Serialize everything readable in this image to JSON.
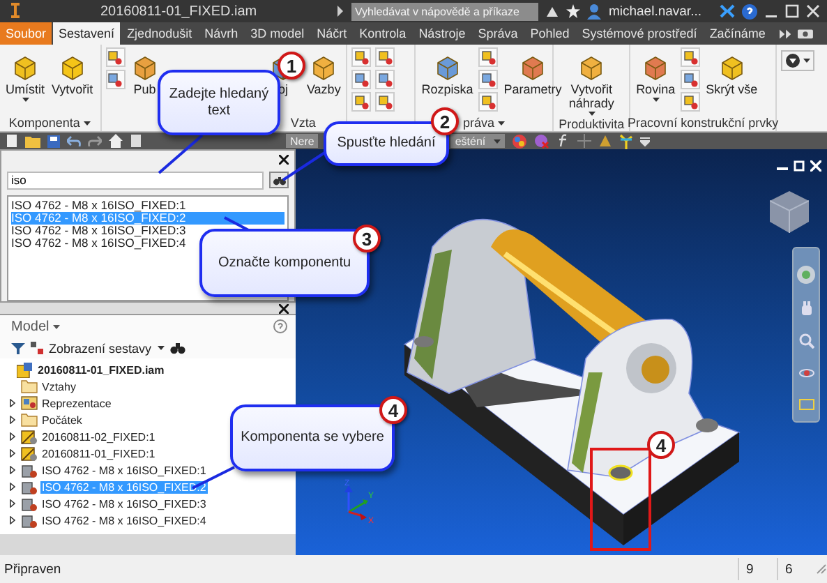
{
  "window": {
    "title": "20160811-01_FIXED.iam"
  },
  "title_bar": {
    "search": {
      "placeholder": "Vyhledávat v nápovědě a příkaze"
    },
    "user": "michael.navar..."
  },
  "ribbon_tabs": [
    {
      "label": "Soubor",
      "kind": "file",
      "selected": false
    },
    {
      "label": "Sestavení",
      "kind": "tab",
      "selected": true
    },
    {
      "label": "Zjednodušit",
      "kind": "tab",
      "selected": false
    },
    {
      "label": "Návrh",
      "kind": "tab",
      "selected": false
    },
    {
      "label": "3D model",
      "kind": "tab",
      "selected": false
    },
    {
      "label": "Náčrt",
      "kind": "tab",
      "selected": false
    },
    {
      "label": "Kontrola",
      "kind": "tab",
      "selected": false
    },
    {
      "label": "Nástroje",
      "kind": "tab",
      "selected": false
    },
    {
      "label": "Správa",
      "kind": "tab",
      "selected": false
    },
    {
      "label": "Pohled",
      "kind": "tab",
      "selected": false
    },
    {
      "label": "Systémové prostředí",
      "kind": "tab",
      "selected": false
    },
    {
      "label": "Začínáme",
      "kind": "tab",
      "selected": false
    }
  ],
  "ribbon_groups": [
    {
      "label": "Komponenta",
      "dropdown": true,
      "items": [
        {
          "kind": "large",
          "label": "Umístit",
          "menu": true
        },
        {
          "kind": "large",
          "label": "Vytvořit",
          "menu": false
        }
      ]
    },
    {
      "label": "Vzta",
      "dropdown": false,
      "items": [
        {
          "kind": "stack2"
        },
        {
          "kind": "large",
          "label": "Pub",
          "menu": false
        },
        {
          "kind": "large",
          "label": "oj",
          "menu": false
        },
        {
          "kind": "large",
          "label": "Vazby",
          "menu": false
        }
      ]
    },
    {
      "items": [
        {
          "kind": "stack3"
        },
        {
          "kind": "stack3"
        }
      ]
    },
    {
      "label": "práva",
      "dropdown": true,
      "items": [
        {
          "kind": "large",
          "label": "Rozpiska",
          "menu": false
        },
        {
          "kind": "stack3"
        },
        {
          "kind": "large",
          "label": "Parametry",
          "menu": false
        }
      ]
    },
    {
      "label": "Produktivita",
      "dropdown": false,
      "items": [
        {
          "kind": "large",
          "label": "Vytvořit náhrady",
          "menu": true
        }
      ]
    },
    {
      "label": "Pracovní konstrukční prvky",
      "dropdown": false,
      "items": [
        {
          "kind": "large",
          "label": "Rovina",
          "menu": true
        },
        {
          "kind": "stack3"
        },
        {
          "kind": "large",
          "label": "Skrýt vše",
          "menu": false
        }
      ]
    },
    {
      "items": [
        {
          "kind": "dropdown"
        }
      ]
    }
  ],
  "quick_access": {
    "dropdowns": [
      "Nere",
      "ešténí"
    ]
  },
  "search_pane": {
    "query": "iso",
    "results": [
      {
        "label": "ISO 4762 - M8 x 16ISO_FIXED:1",
        "selected": false
      },
      {
        "label": "ISO 4762 - M8 x 16ISO_FIXED:2",
        "selected": true
      },
      {
        "label": "ISO 4762 - M8 x 16ISO_FIXED:3",
        "selected": false
      },
      {
        "label": "ISO 4762 - M8 x 16ISO_FIXED:4",
        "selected": false
      }
    ]
  },
  "model_pane": {
    "title": "Model",
    "view": "Zobrazení sestavy",
    "tree": {
      "label": "20160811-01_FIXED.iam",
      "children": [
        {
          "label": "Vztahy",
          "kind": "folder",
          "expandable": false,
          "selected": false
        },
        {
          "label": "Reprezentace",
          "kind": "representation",
          "expandable": true,
          "selected": false
        },
        {
          "label": "Počátek",
          "kind": "folder",
          "expandable": true,
          "selected": false
        },
        {
          "label": "20160811-02_FIXED:1",
          "kind": "assembly",
          "expandable": true,
          "selected": false
        },
        {
          "label": "20160811-01_FIXED:1",
          "kind": "assembly",
          "expandable": true,
          "selected": false
        },
        {
          "label": "ISO 4762 - M8 x 16ISO_FIXED:1",
          "kind": "part",
          "expandable": true,
          "selected": false
        },
        {
          "label": "ISO 4762 - M8 x 16ISO_FIXED:2",
          "kind": "part",
          "expandable": true,
          "selected": true
        },
        {
          "label": "ISO 4762 - M8 x 16ISO_FIXED:3",
          "kind": "part",
          "expandable": true,
          "selected": false
        },
        {
          "label": "ISO 4762 - M8 x 16ISO_FIXED:4",
          "kind": "part",
          "expandable": true,
          "selected": false
        }
      ]
    }
  },
  "viewport": {
    "triad": [
      "Z",
      "Y",
      "X"
    ],
    "marker": "4"
  },
  "callouts": [
    {
      "number": "1",
      "text": "Zadejte hledaný text"
    },
    {
      "number": "2",
      "text": "Spusťte hledání"
    },
    {
      "number": "3",
      "text": "Označte komponentu"
    },
    {
      "number": "4",
      "text": "Komponenta se vybere"
    }
  ],
  "status_bar": {
    "text": "Připraven",
    "cells": [
      "9",
      "6"
    ]
  }
}
